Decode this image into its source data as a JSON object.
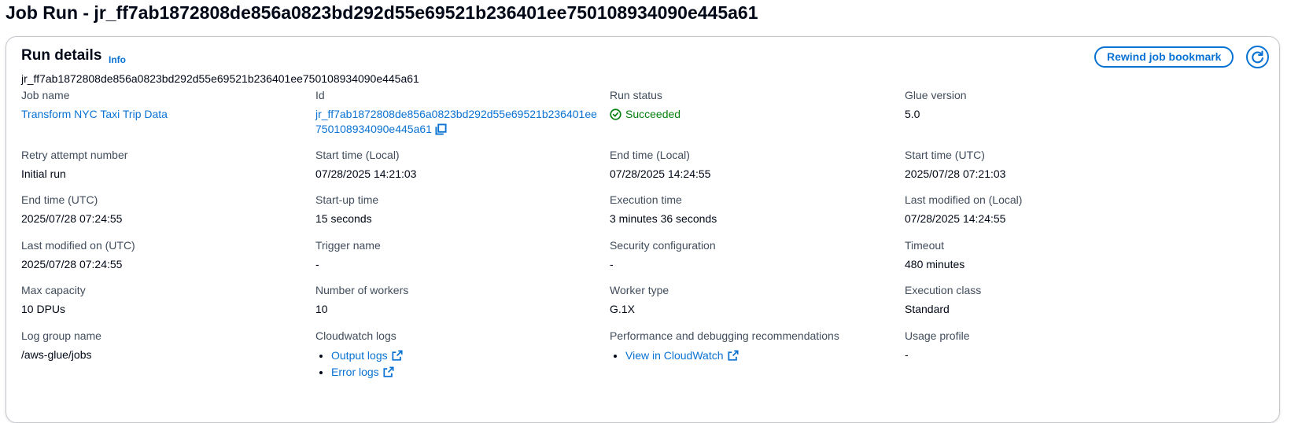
{
  "page": {
    "title": "Job Run - jr_ff7ab1872808de856a0823bd292d55e69521b236401ee750108934090e445a61"
  },
  "panel": {
    "title": "Run details",
    "info_label": "Info",
    "subtitle": "jr_ff7ab1872808de856a0823bd292d55e69521b236401ee750108934090e445a61",
    "rewind_label": "Rewind job bookmark",
    "refresh_icon": "refresh-icon"
  },
  "fields": {
    "job_name": {
      "label": "Job name",
      "value": "Transform NYC Taxi Trip Data"
    },
    "id": {
      "label": "Id",
      "value": "jr_ff7ab1872808de856a0823bd292d55e69521b236401ee750108934090e445a61"
    },
    "run_status": {
      "label": "Run status",
      "value": "Succeeded",
      "color": "#037f0c"
    },
    "glue_version": {
      "label": "Glue version",
      "value": "5.0"
    },
    "retry_attempt": {
      "label": "Retry attempt number",
      "value": "Initial run"
    },
    "start_time_local": {
      "label": "Start time (Local)",
      "value": "07/28/2025 14:21:03"
    },
    "end_time_local": {
      "label": "End time (Local)",
      "value": "07/28/2025 14:24:55"
    },
    "start_time_utc": {
      "label": "Start time (UTC)",
      "value": "2025/07/28 07:21:03"
    },
    "end_time_utc": {
      "label": "End time (UTC)",
      "value": "2025/07/28 07:24:55"
    },
    "startup_time": {
      "label": "Start-up time",
      "value": "15 seconds"
    },
    "execution_time": {
      "label": "Execution time",
      "value": "3 minutes 36 seconds"
    },
    "last_modified_local": {
      "label": "Last modified on (Local)",
      "value": "07/28/2025 14:24:55"
    },
    "last_modified_utc": {
      "label": "Last modified on (UTC)",
      "value": "2025/07/28 07:24:55"
    },
    "trigger_name": {
      "label": "Trigger name",
      "value": "-"
    },
    "security_configuration": {
      "label": "Security configuration",
      "value": "-"
    },
    "timeout": {
      "label": "Timeout",
      "value": "480 minutes"
    },
    "max_capacity": {
      "label": "Max capacity",
      "value": "10 DPUs"
    },
    "number_of_workers": {
      "label": "Number of workers",
      "value": "10"
    },
    "worker_type": {
      "label": "Worker type",
      "value": "G.1X"
    },
    "execution_class": {
      "label": "Execution class",
      "value": "Standard"
    },
    "log_group_name": {
      "label": "Log group name",
      "value": "/aws-glue/jobs"
    },
    "cloudwatch_logs": {
      "label": "Cloudwatch logs",
      "links": [
        "Output logs",
        "Error logs"
      ]
    },
    "performance": {
      "label": "Performance and debugging recommendations",
      "links": [
        "View in CloudWatch"
      ]
    },
    "usage_profile": {
      "label": "Usage profile",
      "value": "-"
    }
  },
  "colors": {
    "link": "#0972d3",
    "success": "#037f0c",
    "label": "#414d5c",
    "text": "#000716"
  }
}
